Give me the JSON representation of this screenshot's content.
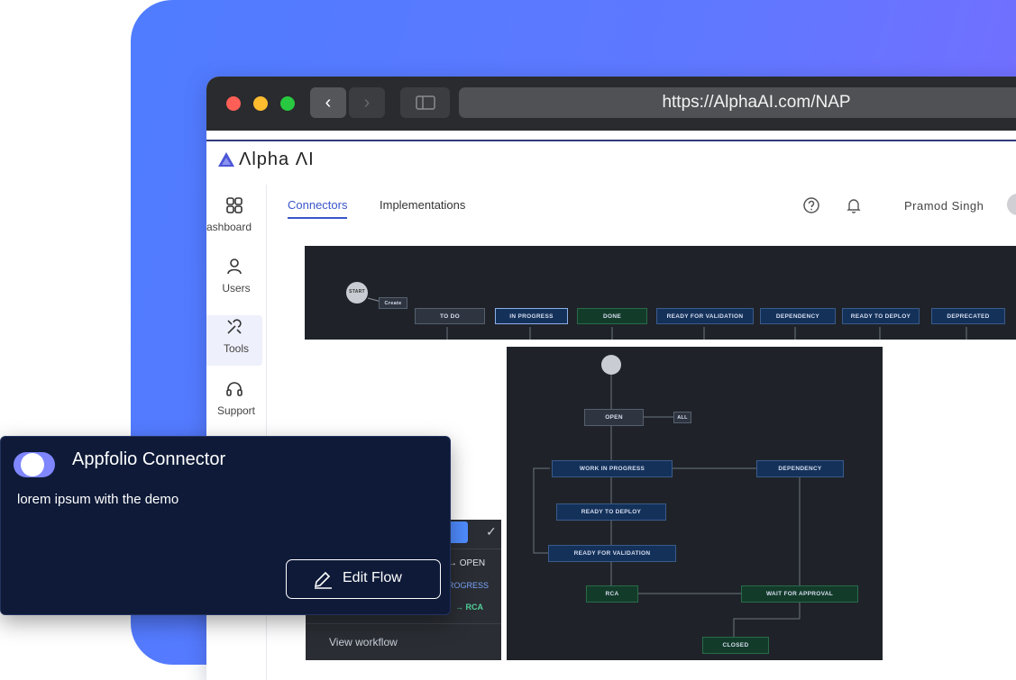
{
  "browser": {
    "url": "https://AlphaAI.com/NAP",
    "colors": {
      "close": "#ff5f57",
      "minimize": "#febc2e",
      "maximize": "#28c840"
    }
  },
  "app": {
    "logo_text": "Λlpha ΛI",
    "sidebar": [
      {
        "label": "ashboard",
        "icon": "dashboard-grid-icon"
      },
      {
        "label": "Users",
        "icon": "user-icon"
      },
      {
        "label": "Tools",
        "icon": "tools-icon"
      },
      {
        "label": "Support",
        "icon": "headset-icon"
      }
    ],
    "tabs": [
      {
        "label": "Connectors",
        "active": true
      },
      {
        "label": "Implementations",
        "active": false
      }
    ],
    "user_name": "Pramod Singh"
  },
  "workflow_top": {
    "start": "START",
    "create": "Create",
    "states": [
      "TO DO",
      "IN PROGRESS",
      "DONE",
      "READY FOR VALIDATION",
      "DEPENDENCY",
      "READY TO DEPLOY",
      "DEPRECATED"
    ]
  },
  "workflow_main": {
    "all_tag": "ALL",
    "states": {
      "open": "OPEN",
      "wip": "WORK IN PROGRESS",
      "dependency": "DEPENDENCY",
      "ready_to_deploy": "READY TO DEPLOY",
      "ready_for_validation": "READY FOR VALIDATION",
      "rca": "RCA",
      "wait_for_approval": "WAIT FOR APPROVAL",
      "closed": "CLOSED"
    }
  },
  "mini_panel": {
    "row1": "→ OPEN",
    "row2": "ROGRESS",
    "row3": "→ RCA",
    "link": "View workflow"
  },
  "card": {
    "title": "Appfolio Connector",
    "description": "lorem ipsum with the demo",
    "button": "Edit Flow",
    "toggle_on": true
  }
}
